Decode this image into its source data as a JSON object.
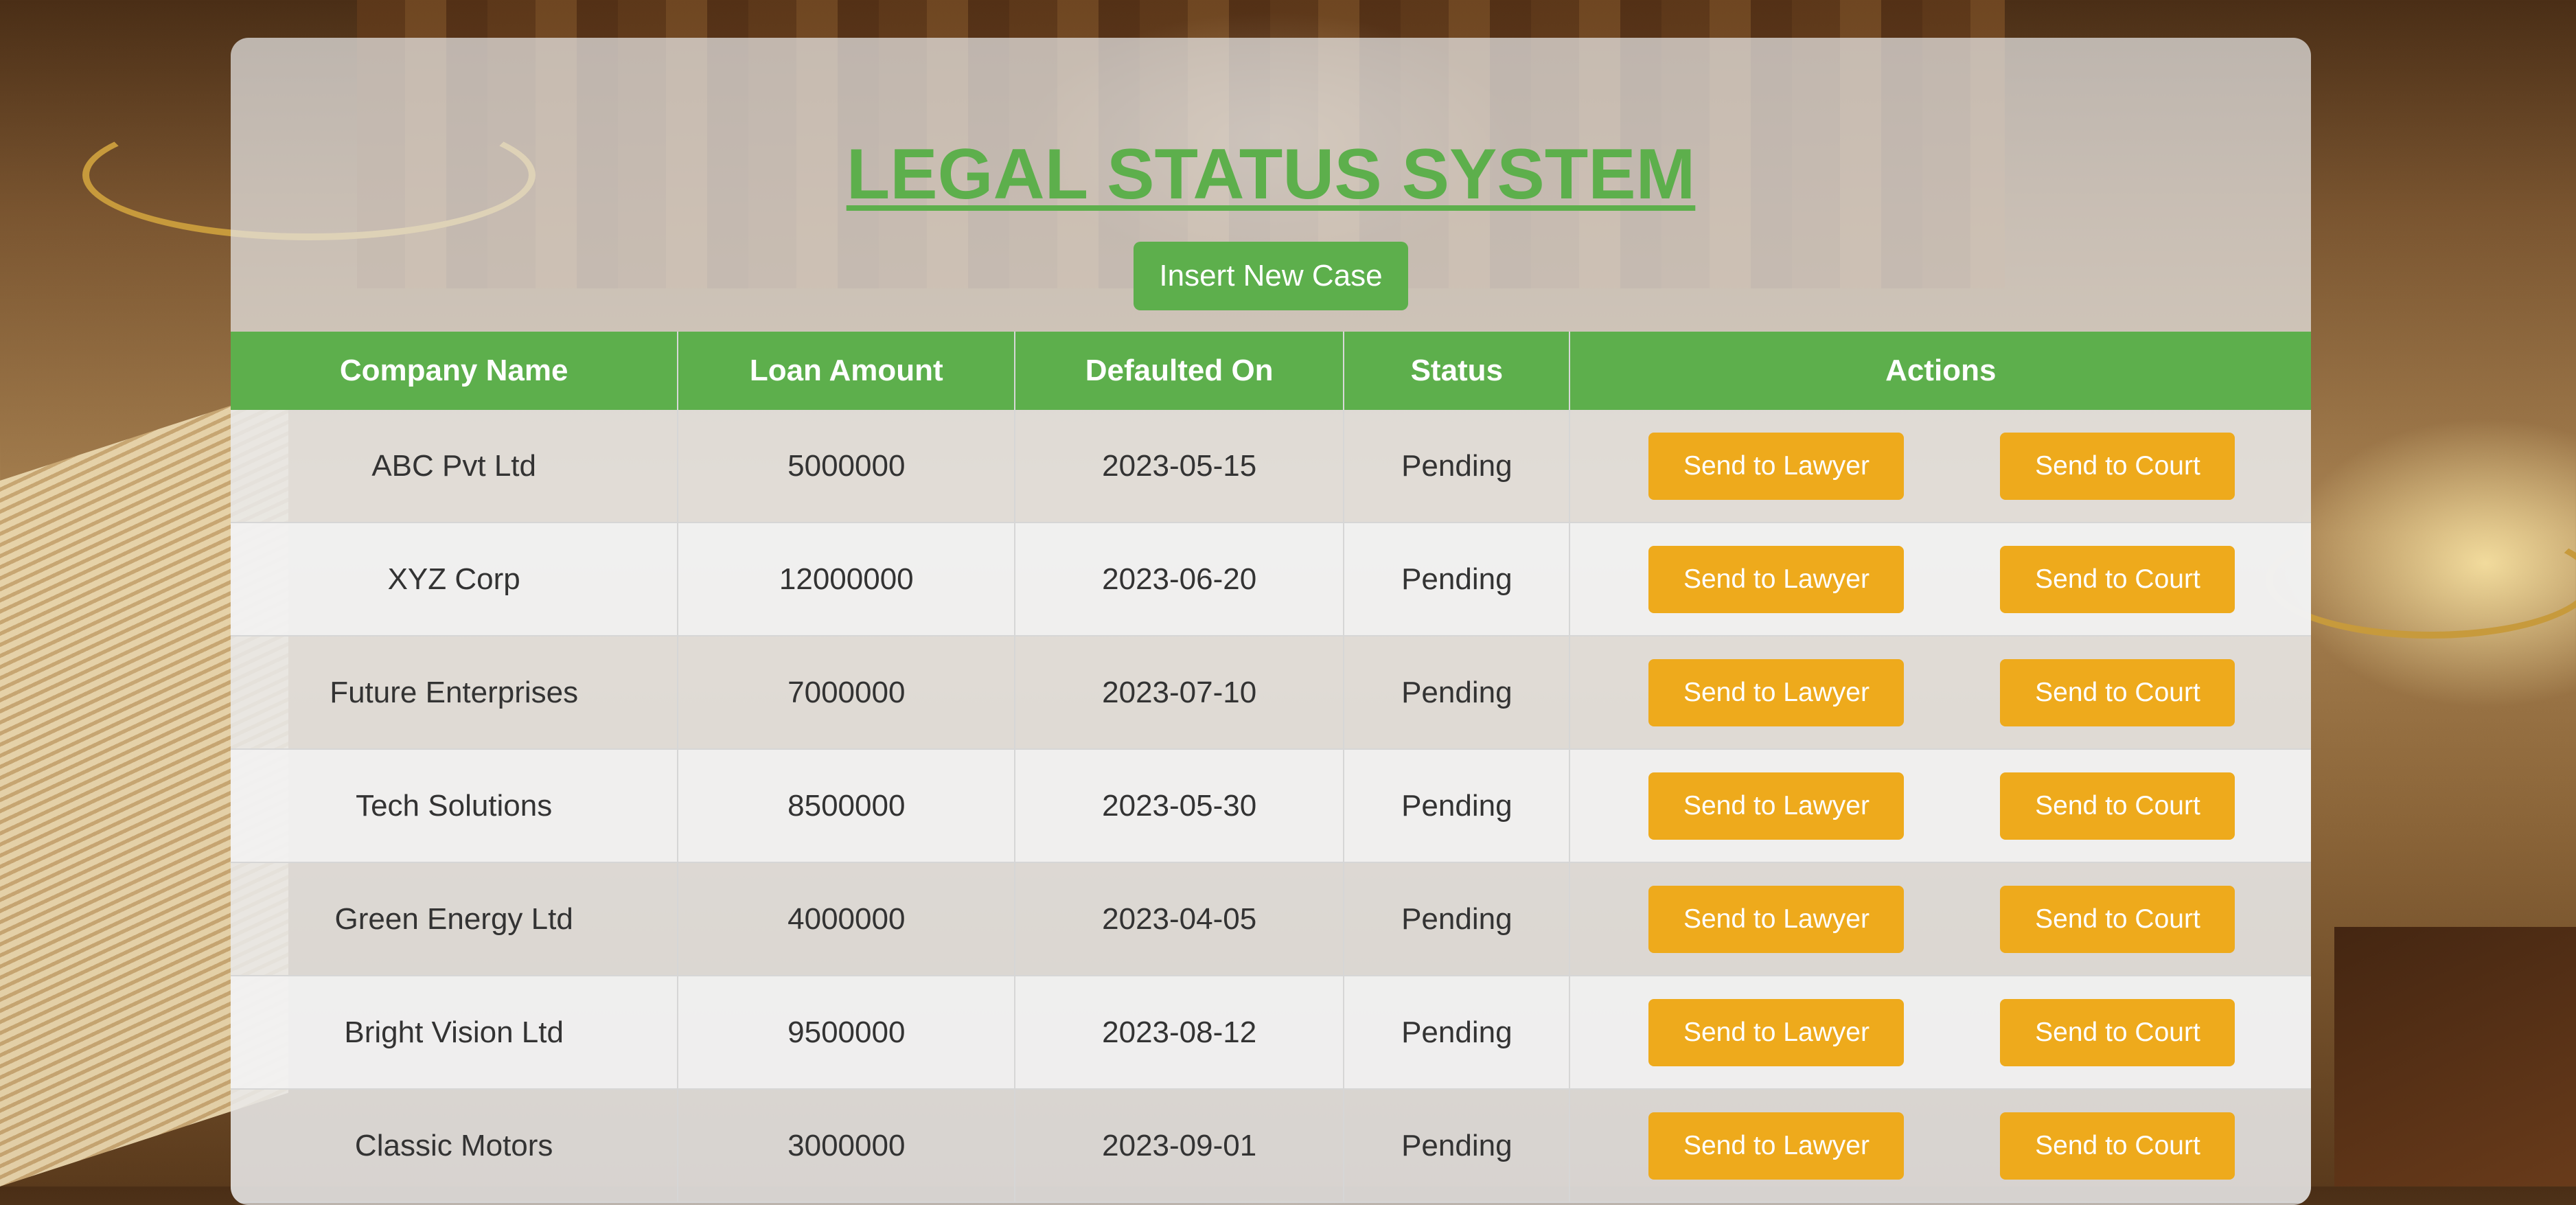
{
  "app": {
    "title": "LEGAL STATUS SYSTEM",
    "insert_button": "Insert New Case"
  },
  "table": {
    "columns": [
      "Company Name",
      "Loan Amount",
      "Defaulted On",
      "Status",
      "Actions"
    ],
    "rows": [
      {
        "company": "ABC Pvt Ltd",
        "amount": "5000000",
        "defaulted": "2023-05-15",
        "status": "Pending"
      },
      {
        "company": "XYZ Corp",
        "amount": "12000000",
        "defaulted": "2023-06-20",
        "status": "Pending"
      },
      {
        "company": "Future Enterprises",
        "amount": "7000000",
        "defaulted": "2023-07-10",
        "status": "Pending"
      },
      {
        "company": "Tech Solutions",
        "amount": "8500000",
        "defaulted": "2023-05-30",
        "status": "Pending"
      },
      {
        "company": "Green Energy Ltd",
        "amount": "4000000",
        "defaulted": "2023-04-05",
        "status": "Pending"
      },
      {
        "company": "Bright Vision Ltd",
        "amount": "9500000",
        "defaulted": "2023-08-12",
        "status": "Pending"
      },
      {
        "company": "Classic Motors",
        "amount": "3000000",
        "defaulted": "2023-09-01",
        "status": "Pending"
      }
    ],
    "actions": {
      "lawyer_label": "Send to Lawyer",
      "court_label": "Send to Court"
    }
  },
  "colors": {
    "accent_green": "#5daf4c",
    "action_orange": "#eeaa1c"
  }
}
